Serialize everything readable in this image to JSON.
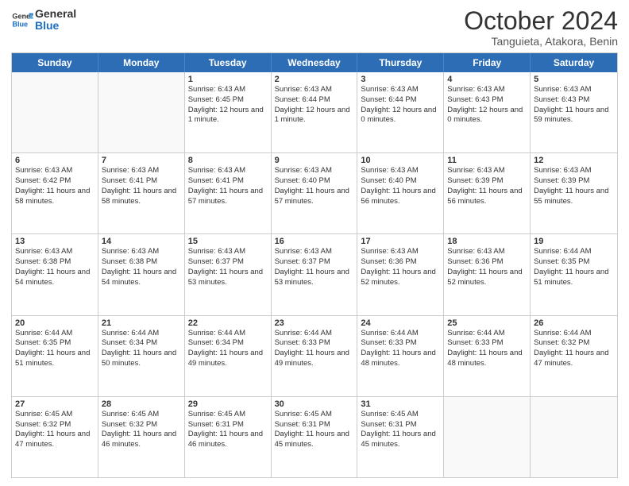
{
  "logo": {
    "line1": "General",
    "line2": "Blue"
  },
  "title": "October 2024",
  "location": "Tanguieta, Atakora, Benin",
  "days_of_week": [
    "Sunday",
    "Monday",
    "Tuesday",
    "Wednesday",
    "Thursday",
    "Friday",
    "Saturday"
  ],
  "weeks": [
    [
      {
        "day": "",
        "sunrise": "",
        "sunset": "",
        "daylight": "",
        "empty": true
      },
      {
        "day": "",
        "sunrise": "",
        "sunset": "",
        "daylight": "",
        "empty": true
      },
      {
        "day": "1",
        "sunrise": "Sunrise: 6:43 AM",
        "sunset": "Sunset: 6:45 PM",
        "daylight": "Daylight: 12 hours and 1 minute."
      },
      {
        "day": "2",
        "sunrise": "Sunrise: 6:43 AM",
        "sunset": "Sunset: 6:44 PM",
        "daylight": "Daylight: 12 hours and 1 minute."
      },
      {
        "day": "3",
        "sunrise": "Sunrise: 6:43 AM",
        "sunset": "Sunset: 6:44 PM",
        "daylight": "Daylight: 12 hours and 0 minutes."
      },
      {
        "day": "4",
        "sunrise": "Sunrise: 6:43 AM",
        "sunset": "Sunset: 6:43 PM",
        "daylight": "Daylight: 12 hours and 0 minutes."
      },
      {
        "day": "5",
        "sunrise": "Sunrise: 6:43 AM",
        "sunset": "Sunset: 6:43 PM",
        "daylight": "Daylight: 11 hours and 59 minutes."
      }
    ],
    [
      {
        "day": "6",
        "sunrise": "Sunrise: 6:43 AM",
        "sunset": "Sunset: 6:42 PM",
        "daylight": "Daylight: 11 hours and 58 minutes."
      },
      {
        "day": "7",
        "sunrise": "Sunrise: 6:43 AM",
        "sunset": "Sunset: 6:41 PM",
        "daylight": "Daylight: 11 hours and 58 minutes."
      },
      {
        "day": "8",
        "sunrise": "Sunrise: 6:43 AM",
        "sunset": "Sunset: 6:41 PM",
        "daylight": "Daylight: 11 hours and 57 minutes."
      },
      {
        "day": "9",
        "sunrise": "Sunrise: 6:43 AM",
        "sunset": "Sunset: 6:40 PM",
        "daylight": "Daylight: 11 hours and 57 minutes."
      },
      {
        "day": "10",
        "sunrise": "Sunrise: 6:43 AM",
        "sunset": "Sunset: 6:40 PM",
        "daylight": "Daylight: 11 hours and 56 minutes."
      },
      {
        "day": "11",
        "sunrise": "Sunrise: 6:43 AM",
        "sunset": "Sunset: 6:39 PM",
        "daylight": "Daylight: 11 hours and 56 minutes."
      },
      {
        "day": "12",
        "sunrise": "Sunrise: 6:43 AM",
        "sunset": "Sunset: 6:39 PM",
        "daylight": "Daylight: 11 hours and 55 minutes."
      }
    ],
    [
      {
        "day": "13",
        "sunrise": "Sunrise: 6:43 AM",
        "sunset": "Sunset: 6:38 PM",
        "daylight": "Daylight: 11 hours and 54 minutes."
      },
      {
        "day": "14",
        "sunrise": "Sunrise: 6:43 AM",
        "sunset": "Sunset: 6:38 PM",
        "daylight": "Daylight: 11 hours and 54 minutes."
      },
      {
        "day": "15",
        "sunrise": "Sunrise: 6:43 AM",
        "sunset": "Sunset: 6:37 PM",
        "daylight": "Daylight: 11 hours and 53 minutes."
      },
      {
        "day": "16",
        "sunrise": "Sunrise: 6:43 AM",
        "sunset": "Sunset: 6:37 PM",
        "daylight": "Daylight: 11 hours and 53 minutes."
      },
      {
        "day": "17",
        "sunrise": "Sunrise: 6:43 AM",
        "sunset": "Sunset: 6:36 PM",
        "daylight": "Daylight: 11 hours and 52 minutes."
      },
      {
        "day": "18",
        "sunrise": "Sunrise: 6:43 AM",
        "sunset": "Sunset: 6:36 PM",
        "daylight": "Daylight: 11 hours and 52 minutes."
      },
      {
        "day": "19",
        "sunrise": "Sunrise: 6:44 AM",
        "sunset": "Sunset: 6:35 PM",
        "daylight": "Daylight: 11 hours and 51 minutes."
      }
    ],
    [
      {
        "day": "20",
        "sunrise": "Sunrise: 6:44 AM",
        "sunset": "Sunset: 6:35 PM",
        "daylight": "Daylight: 11 hours and 51 minutes."
      },
      {
        "day": "21",
        "sunrise": "Sunrise: 6:44 AM",
        "sunset": "Sunset: 6:34 PM",
        "daylight": "Daylight: 11 hours and 50 minutes."
      },
      {
        "day": "22",
        "sunrise": "Sunrise: 6:44 AM",
        "sunset": "Sunset: 6:34 PM",
        "daylight": "Daylight: 11 hours and 49 minutes."
      },
      {
        "day": "23",
        "sunrise": "Sunrise: 6:44 AM",
        "sunset": "Sunset: 6:33 PM",
        "daylight": "Daylight: 11 hours and 49 minutes."
      },
      {
        "day": "24",
        "sunrise": "Sunrise: 6:44 AM",
        "sunset": "Sunset: 6:33 PM",
        "daylight": "Daylight: 11 hours and 48 minutes."
      },
      {
        "day": "25",
        "sunrise": "Sunrise: 6:44 AM",
        "sunset": "Sunset: 6:33 PM",
        "daylight": "Daylight: 11 hours and 48 minutes."
      },
      {
        "day": "26",
        "sunrise": "Sunrise: 6:44 AM",
        "sunset": "Sunset: 6:32 PM",
        "daylight": "Daylight: 11 hours and 47 minutes."
      }
    ],
    [
      {
        "day": "27",
        "sunrise": "Sunrise: 6:45 AM",
        "sunset": "Sunset: 6:32 PM",
        "daylight": "Daylight: 11 hours and 47 minutes."
      },
      {
        "day": "28",
        "sunrise": "Sunrise: 6:45 AM",
        "sunset": "Sunset: 6:32 PM",
        "daylight": "Daylight: 11 hours and 46 minutes."
      },
      {
        "day": "29",
        "sunrise": "Sunrise: 6:45 AM",
        "sunset": "Sunset: 6:31 PM",
        "daylight": "Daylight: 11 hours and 46 minutes."
      },
      {
        "day": "30",
        "sunrise": "Sunrise: 6:45 AM",
        "sunset": "Sunset: 6:31 PM",
        "daylight": "Daylight: 11 hours and 45 minutes."
      },
      {
        "day": "31",
        "sunrise": "Sunrise: 6:45 AM",
        "sunset": "Sunset: 6:31 PM",
        "daylight": "Daylight: 11 hours and 45 minutes."
      },
      {
        "day": "",
        "sunrise": "",
        "sunset": "",
        "daylight": "",
        "empty": true
      },
      {
        "day": "",
        "sunrise": "",
        "sunset": "",
        "daylight": "",
        "empty": true
      }
    ]
  ]
}
